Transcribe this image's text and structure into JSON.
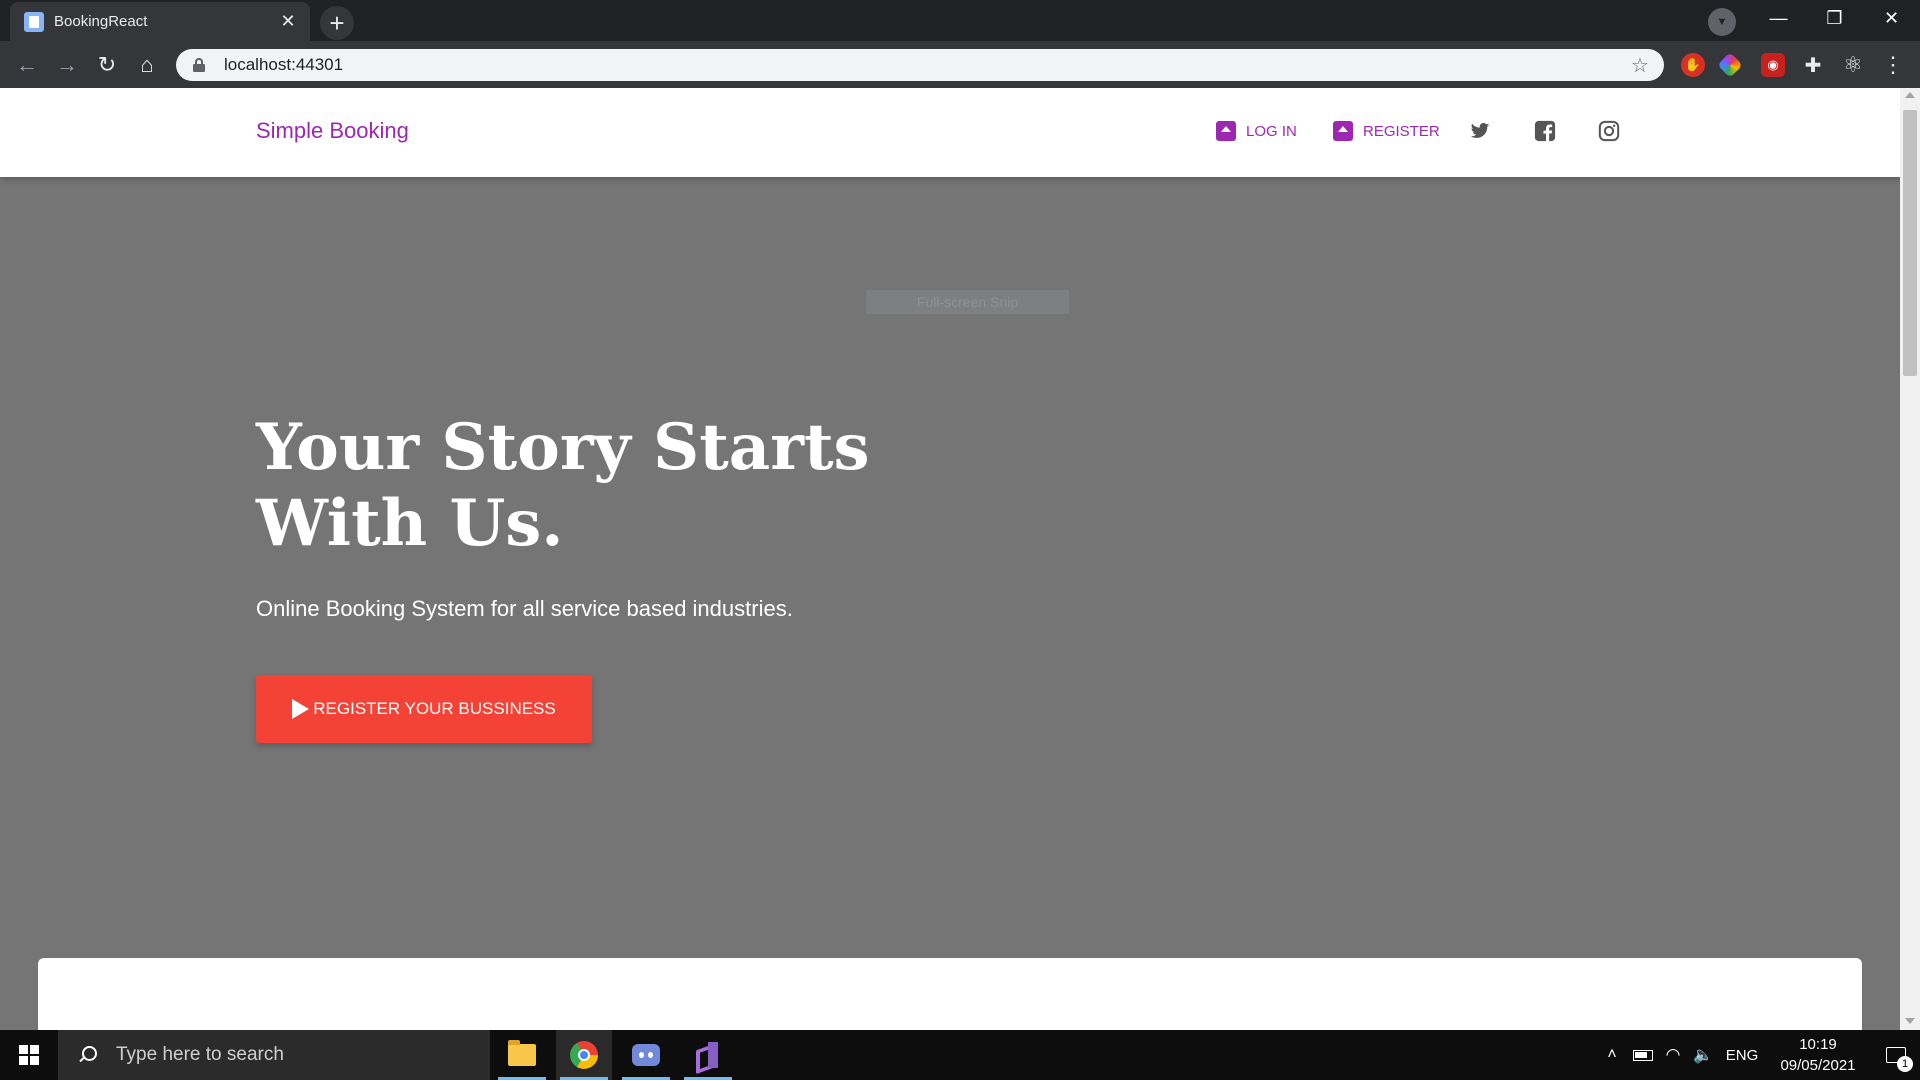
{
  "browser": {
    "tab_title": "BookingReact",
    "tab_close": "✕",
    "new_tab": "+",
    "url": "localhost:44301",
    "window_controls": {
      "minimize": "—",
      "maximize": "❐",
      "close": "✕"
    }
  },
  "site": {
    "brand": "Simple Booking",
    "nav": [
      {
        "label": "LOG IN",
        "icon": "login-icon"
      },
      {
        "label": "REGISTER",
        "icon": "register-icon"
      }
    ],
    "social": [
      "twitter-icon",
      "facebook-icon",
      "instagram-icon"
    ],
    "accent_color": "#9c27b0",
    "overlay_label": "Full-screen Snip"
  },
  "hero": {
    "title_line1": "Your Story Starts",
    "title_line2": "With Us.",
    "subtitle": "Online Booking System for all service based industries.",
    "cta_label": "REGISTER YOUR BUSSINESS",
    "cta_color": "#f44336",
    "background": "#757575"
  },
  "taskbar": {
    "search_placeholder": "Type here to search",
    "apps": [
      "file-explorer-icon",
      "chrome-icon",
      "discord-icon",
      "visual-studio-icon"
    ],
    "language": "ENG",
    "time": "10:19",
    "date": "09/05/2021",
    "notification_count": "1"
  }
}
